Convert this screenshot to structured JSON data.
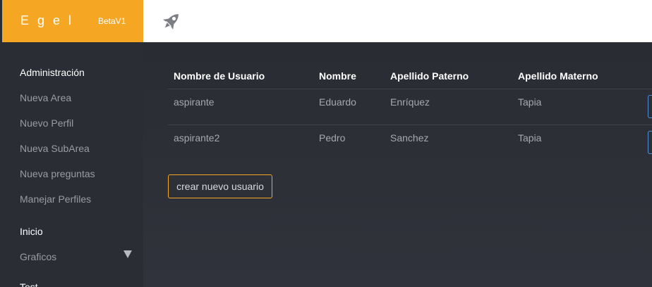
{
  "brand": {
    "name": "Egel",
    "version": "BetaV1",
    "color": "#f5a623"
  },
  "topbar": {
    "icon": "rocket-icon"
  },
  "sidebar": {
    "sections": [
      {
        "label": "Administración",
        "type": "header"
      },
      {
        "label": "Nueva Area",
        "type": "item"
      },
      {
        "label": "Nuevo Perfil",
        "type": "item"
      },
      {
        "label": "Nueva SubArea",
        "type": "item"
      },
      {
        "label": "Nueva preguntas",
        "type": "item"
      },
      {
        "label": "Manejar Perfiles",
        "type": "item"
      },
      {
        "label": "Inicio",
        "type": "header"
      },
      {
        "label": "Graficos",
        "type": "item",
        "icon": "caret-down-icon"
      },
      {
        "label": "Test",
        "type": "header"
      }
    ]
  },
  "table": {
    "headers": [
      "Nombre de Usuario",
      "Nombre",
      "Apellido Paterno",
      "Apellido Materno"
    ],
    "rows": [
      [
        "aspirante",
        "Eduardo",
        "Enríquez",
        "Tapia"
      ],
      [
        "aspirante2",
        "Pedro",
        "Sanchez",
        "Tapia"
      ]
    ]
  },
  "actions": {
    "create_user_label": "crear nuevo usuario"
  }
}
